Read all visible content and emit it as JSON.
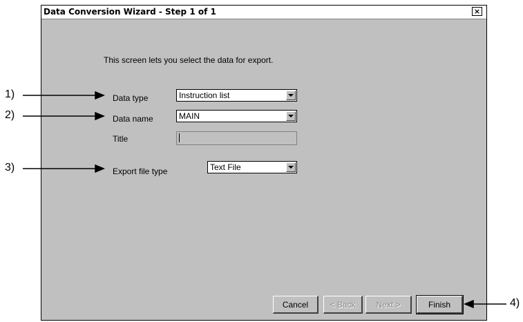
{
  "window": {
    "title": "Data Conversion Wizard - Step 1 of 1",
    "close_glyph": "×"
  },
  "intro_text": "This screen lets you select the data for export.",
  "fields": {
    "data_type": {
      "label": "Data type",
      "value": "Instruction list"
    },
    "data_name": {
      "label": "Data name",
      "value": "MAIN"
    },
    "title": {
      "label": "Title",
      "value": ""
    },
    "export_file_type": {
      "label": "Export file type",
      "value": "Text File"
    }
  },
  "buttons": {
    "cancel": "Cancel",
    "back": "< Back",
    "next": "Next >",
    "finish": "Finish"
  },
  "annotations": {
    "a1": "1)",
    "a2": "2)",
    "a3": "3)",
    "a4": "4)"
  }
}
